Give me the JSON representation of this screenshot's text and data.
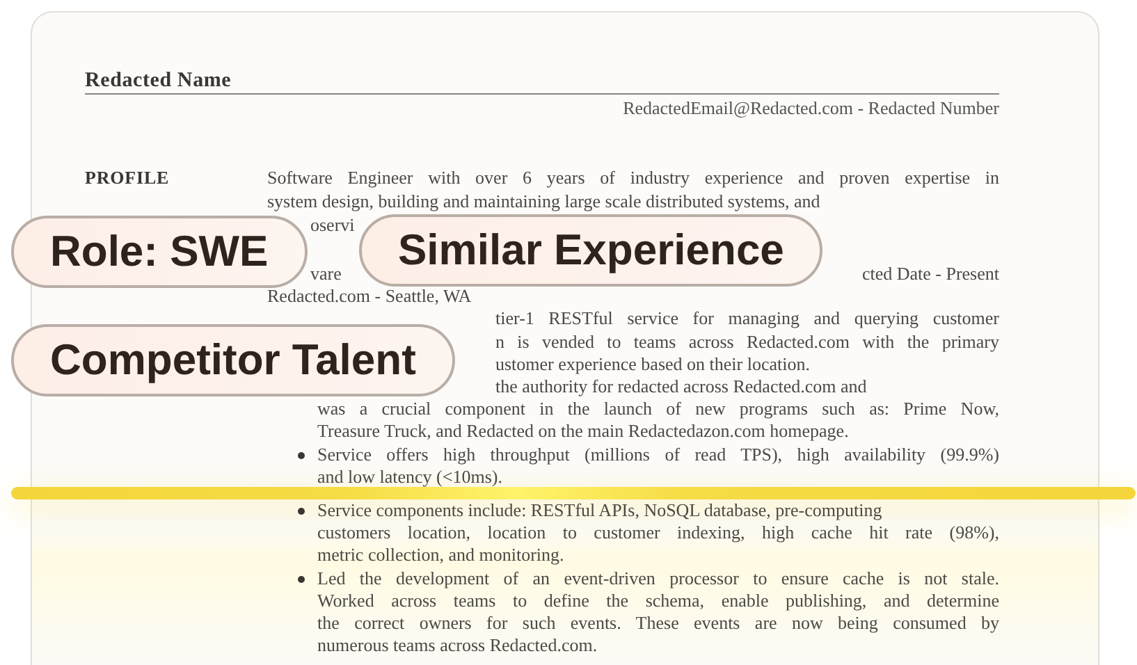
{
  "resume": {
    "name": "Redacted Name",
    "contact": "RedactedEmail@Redacted.com - Redacted Number"
  },
  "profile": {
    "heading": "PROFILE",
    "lines": [
      {
        "text": "Software Engineer with over 6 years of industry experience and proven expertise in",
        "clipped": false,
        "justify": true
      },
      {
        "text": "system design, building and maintaining large scale distributed systems, and",
        "clipped": false,
        "justify": false
      },
      {
        "text": "oservi",
        "clipped": true,
        "justify": false
      }
    ]
  },
  "experience": {
    "title_left": "vare",
    "title_right": "cted Date - Present",
    "place": "Redacted.com - Seattle, WA",
    "bullets": [
      {
        "marker": false,
        "lines": [
          {
            "text": "tier-1 RESTful service for managing and querying customer",
            "clipped": true,
            "justify": true
          },
          {
            "text": "n is vended to teams across Redacted.com with the primary",
            "clipped": true,
            "justify": true
          },
          {
            "text": "ustomer experience based on their location.",
            "clipped": true,
            "justify": false
          },
          {
            "text": "the authority for redacted across Redacted.com and",
            "clipped": true,
            "justify": false
          },
          {
            "text": "was a crucial component in the launch of new programs such as: Prime Now,",
            "clipped": false,
            "justify": true
          },
          {
            "text": "Treasure Truck, and Redacted on the main Redactedazon.com homepage.",
            "clipped": false,
            "justify": false
          }
        ]
      },
      {
        "marker": true,
        "lines": [
          {
            "text": "Service offers high throughput (millions of read TPS), high availability (99.9%)",
            "clipped": false,
            "justify": true
          },
          {
            "text": "and low latency (<10ms).",
            "clipped": false,
            "justify": false
          }
        ]
      },
      {
        "marker": true,
        "lines": [
          {
            "text": "Service components include: RESTful APIs, NoSQL database, pre-computing",
            "clipped": false,
            "justify": false
          },
          {
            "text": "customers location, location to customer indexing, high cache hit rate (98%),",
            "clipped": false,
            "justify": true
          },
          {
            "text": "metric collection, and monitoring.",
            "clipped": false,
            "justify": false
          }
        ]
      },
      {
        "marker": true,
        "lines": [
          {
            "text": "Led the development of an event-driven processor to ensure cache is not stale.",
            "clipped": false,
            "justify": true
          },
          {
            "text": "Worked across teams to define the schema, enable publishing, and determine",
            "clipped": false,
            "justify": true
          },
          {
            "text": "the correct owners for such events.  These events are now being consumed by",
            "clipped": false,
            "justify": true
          },
          {
            "text": "numerous teams across Redacted.com.",
            "clipped": false,
            "justify": false
          }
        ]
      }
    ]
  },
  "tags": [
    {
      "label": "Role: SWE"
    },
    {
      "label": "Similar Experience"
    },
    {
      "label": "Competitor Talent"
    }
  ]
}
